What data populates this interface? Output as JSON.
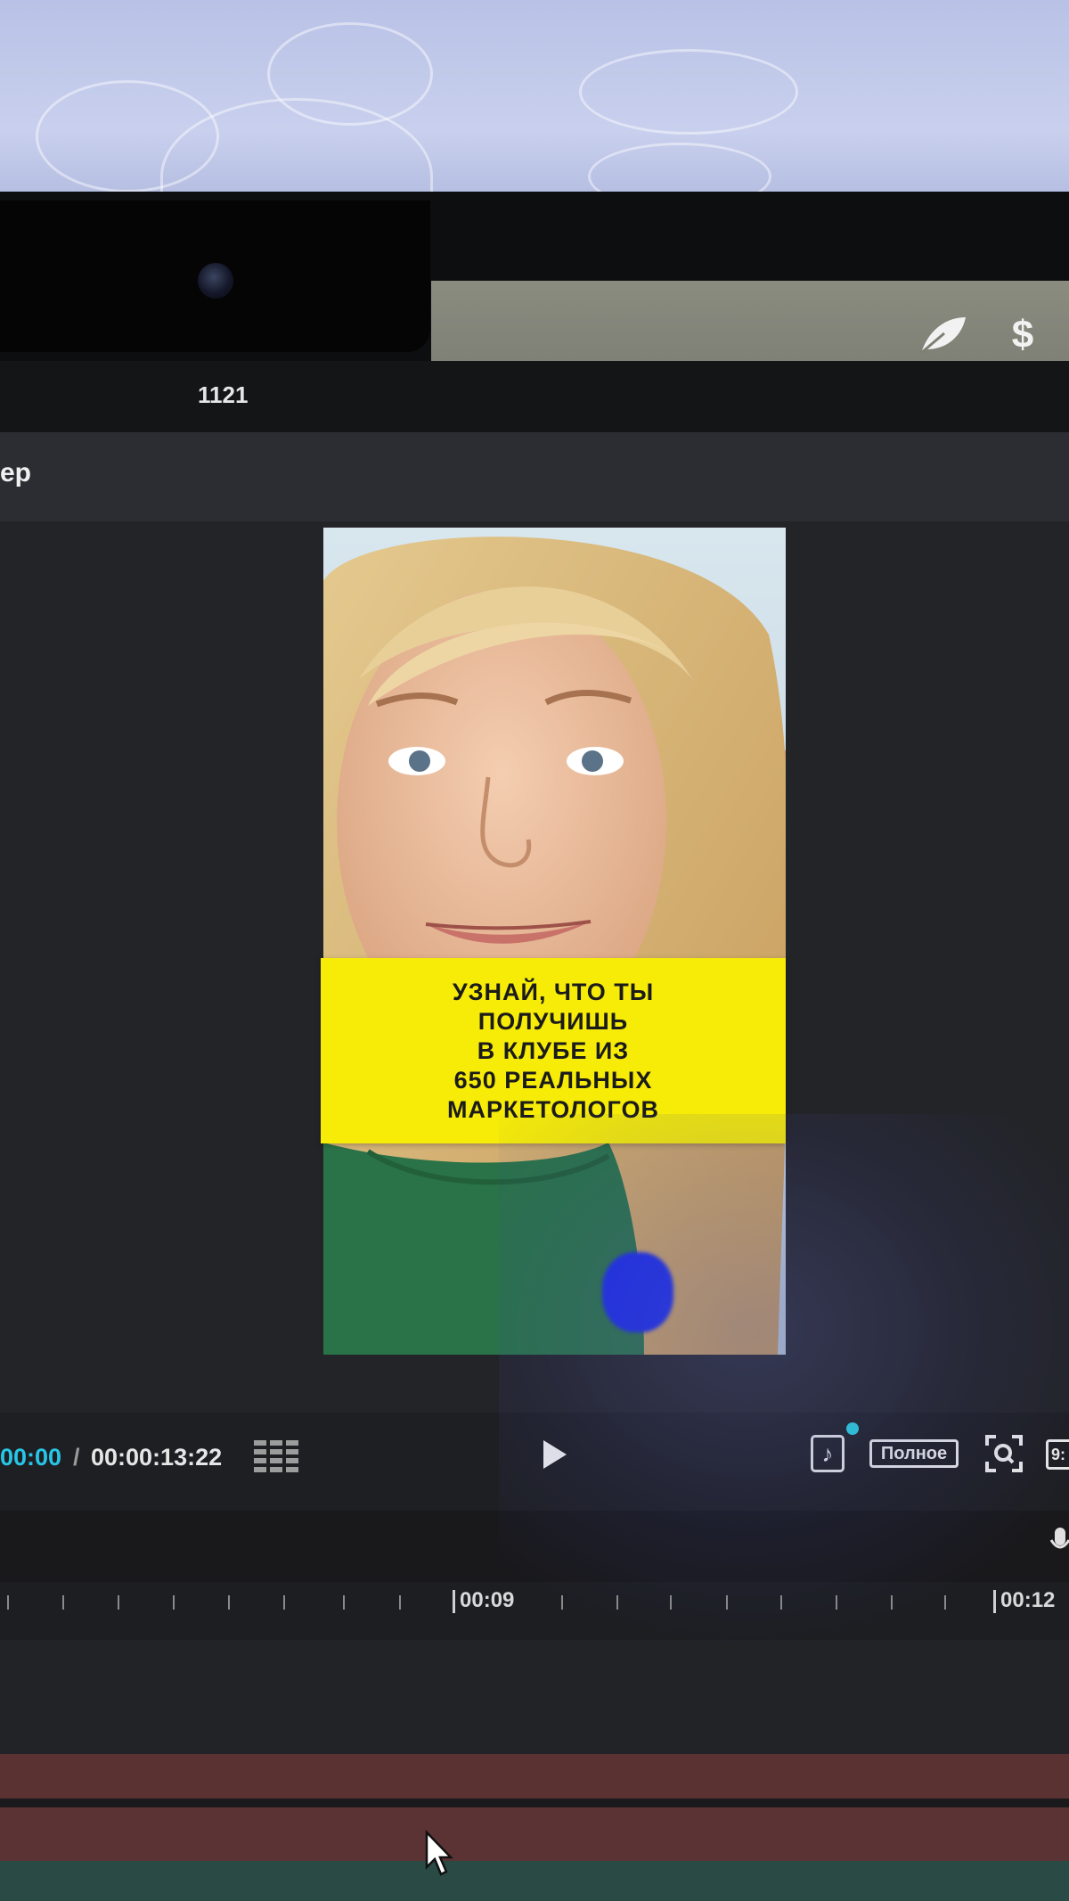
{
  "menubar": {
    "icons": [
      "leaf-icon",
      "dollar-icon"
    ]
  },
  "app": {
    "frame_count": "1121",
    "player_label": "ер"
  },
  "preview": {
    "caption_lines": [
      "УЗНАЙ, ЧТО ТЫ",
      "ПОЛУЧИШЬ",
      "В КЛУБЕ ИЗ",
      "650 РЕАЛЬНЫХ",
      "МАРКЕТОЛОГОВ"
    ]
  },
  "playback": {
    "current_time": "00:00",
    "separator": "/",
    "total_time": "00:00:13:22",
    "tiktok_label": "♪",
    "full_label": "Полное",
    "ratio_label": "9:"
  },
  "timeline": {
    "labels": [
      "00:09",
      "00:12"
    ]
  },
  "colors": {
    "caption_bg": "#f7ec07",
    "time_accent": "#26c6e6",
    "track": "#5a3232"
  }
}
